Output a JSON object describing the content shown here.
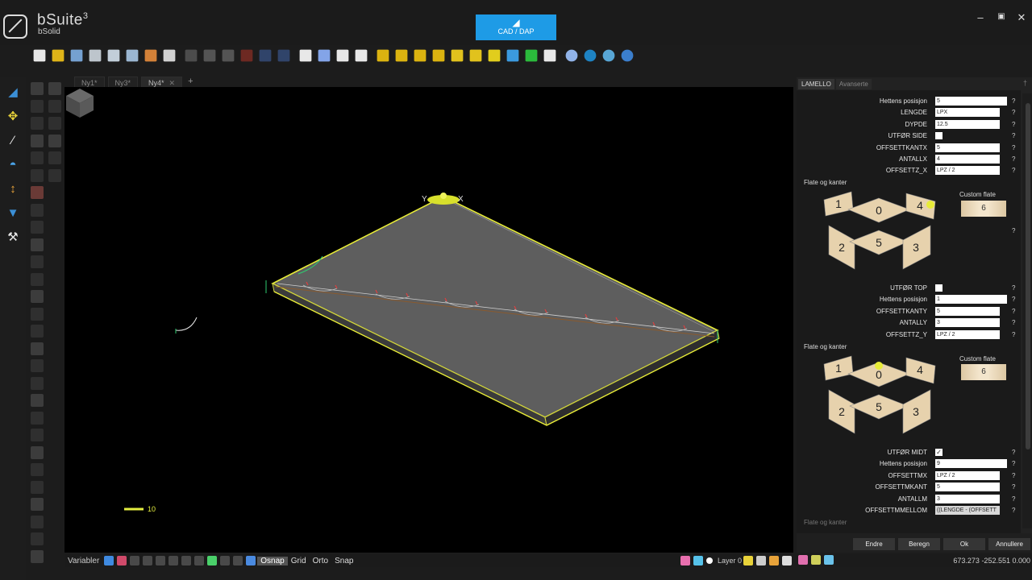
{
  "app": {
    "name": "bSuite",
    "version_sup": "3",
    "subtitle": "bSolid"
  },
  "mode_button": {
    "icon": "set-square-icon",
    "label": "CAD / DAP"
  },
  "window_controls": {
    "minimize": "–",
    "restore": "▣",
    "close": "✕"
  },
  "toolbar": {
    "icons": [
      "new-file-icon",
      "open-folder-icon",
      "save-icon",
      "save-as-icon",
      "export-icon",
      "import-icon",
      "send-icon",
      "print-icon",
      "cut-icon",
      "copy-icon",
      "paste-icon",
      "delete-icon",
      "undo-icon",
      "redo-icon",
      "move-icon",
      "snap-icon",
      "pan-icon",
      "zoom-icon",
      "view-front-icon",
      "view-back-icon",
      "view-left-icon",
      "view-right-icon",
      "view-top-icon",
      "view-bottom-icon",
      "view-iso-icon",
      "view-3d-icon",
      "cursor-icon",
      "refresh-icon",
      "globe-wire-icon",
      "sphere-icon",
      "shaded-sphere-icon",
      "help-icon"
    ],
    "colors": [
      "#ffffff",
      "#f5c518",
      "#7fb0e6",
      "#cfd8e0",
      "#d5e2ee",
      "#aac8e6",
      "#e88d3c",
      "#e6e6e6",
      "#888888",
      "#9a9a9a",
      "#9a9a9a",
      "#d0392b",
      "#4a76c9",
      "#4a76c9",
      "#ffffff",
      "#8fb4ff",
      "#ffffff",
      "#ffffff",
      "#f1c40f",
      "#f1c40f",
      "#f1c40f",
      "#f1c40f",
      "#f7d51e",
      "#f7d51e",
      "#f7e11e",
      "#3fa9f5",
      "#2ecc40",
      "#ffffff",
      "#9fc4ff",
      "#1f8fd6",
      "#5fb6ea",
      "#3f8ae0"
    ]
  },
  "left_tools": [
    {
      "name": "draw-tool-icon",
      "glyph": "◢",
      "color": "#3b8fd6"
    },
    {
      "name": "dimension-tool-icon",
      "glyph": "✥",
      "color": "#e8d23a"
    },
    {
      "name": "edit-tool-icon",
      "glyph": "∕",
      "color": "#e8e8e8"
    },
    {
      "name": "measure-tool-icon",
      "glyph": "◓",
      "color": "#4aa3e8"
    },
    {
      "name": "cnc-tool-icon",
      "glyph": "↕",
      "color": "#e8a33a"
    },
    {
      "name": "shield-tool-icon",
      "glyph": "▼",
      "color": "#3b8fd6"
    },
    {
      "name": "wrench-tool-icon",
      "glyph": "⚒",
      "color": "#e8e8e8"
    }
  ],
  "tabs": [
    {
      "label": "Ny1*",
      "active": false
    },
    {
      "label": "Ny3*",
      "active": false
    },
    {
      "label": "Ny4*",
      "active": true
    }
  ],
  "tab_close": "✕",
  "tab_add": "+",
  "viewport": {
    "axis_y": "Y",
    "axis_x": "X",
    "scale_label": "10"
  },
  "statusbar": {
    "variables": "Variabler",
    "toggles": [
      {
        "label": "Osnap",
        "on": true
      },
      {
        "label": "Grid",
        "on": false
      },
      {
        "label": "Orto",
        "on": false
      },
      {
        "label": "Snap",
        "on": false
      }
    ],
    "layer": "Layer 0"
  },
  "panel": {
    "tabs": [
      {
        "label": "LAMELLO",
        "active": true
      },
      {
        "label": "Avanserte",
        "active": false
      }
    ],
    "pin": "†",
    "group1": [
      {
        "label": "Hettens posisjon",
        "value": "5",
        "wide": true
      },
      {
        "label": "LENGDE",
        "value": "LPX"
      },
      {
        "label": "DYPDE",
        "value": "12.5"
      },
      {
        "label": "UTFØR SIDE",
        "check": ""
      },
      {
        "label": "OFFSETTKANTX",
        "value": "5"
      },
      {
        "label": "ANTALLX",
        "value": "4"
      },
      {
        "label": "OFFSETTZ_X",
        "value": "LPZ / 2"
      }
    ],
    "section1": {
      "title": "Flate og kanter",
      "custom_title": "Custom flate",
      "custom_value": "6"
    },
    "group2": [
      {
        "label": "UTFØR TOP",
        "check": ""
      },
      {
        "label": "Hettens posisjon",
        "value": "1",
        "wide": true
      },
      {
        "label": "OFFSETTKANTY",
        "value": "5"
      },
      {
        "label": "ANTALLY",
        "value": "3"
      },
      {
        "label": "OFFSETTZ_Y",
        "value": "LPZ / 2"
      }
    ],
    "section2": {
      "title": "Flate og kanter",
      "custom_title": "Custom flate",
      "custom_value": "6"
    },
    "group3": [
      {
        "label": "UTFØR MIDT",
        "check": "✓"
      },
      {
        "label": "Hettens posisjon",
        "value": "9",
        "wide": true
      },
      {
        "label": "OFFSETTMX",
        "value": "LPZ / 2"
      },
      {
        "label": "OFFSETTMKANT",
        "value": "5"
      },
      {
        "label": "ANTALLM",
        "value": "3"
      },
      {
        "label": "OFFSETTMMELLOM",
        "value": "((LENGDE - (OFFSETT",
        "ro": true
      }
    ],
    "section3_title": "Flate og kanter",
    "help": "?",
    "faces": {
      "f1": "1",
      "f0": "0",
      "f4": "4",
      "f2": "2",
      "f5": "5",
      "f3": "3"
    }
  },
  "buttons": {
    "endre": "Endre",
    "beregn": "Beregn",
    "ok": "Ok",
    "annullere": "Annullere"
  },
  "coords": "673.273  -252.551  0.000"
}
